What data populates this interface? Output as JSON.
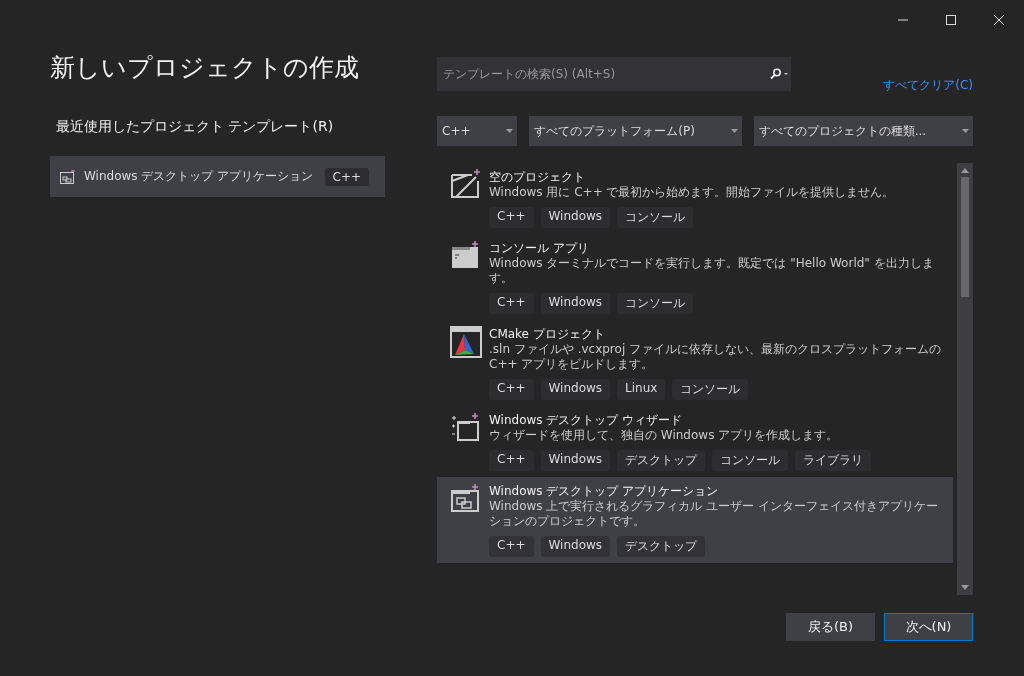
{
  "window": {
    "title": "新しいプロジェクトの作成"
  },
  "recent": {
    "heading": "最近使用したプロジェクト テンプレート(R)",
    "items": [
      {
        "name": "Windows デスクトップ アプリケーション",
        "tag": "C++",
        "kind": "desktop"
      }
    ]
  },
  "search": {
    "placeholder": "テンプレートの検索(S) (Alt+S)"
  },
  "clear_all": "すべてクリア(C)",
  "filters": [
    {
      "value": "C++"
    },
    {
      "value": "すべてのプラットフォーム(P)"
    },
    {
      "value": "すべてのプロジェクトの種類..."
    }
  ],
  "templates": [
    {
      "kind": "empty",
      "name": "空のプロジェクト",
      "description": "Windows 用に C++ で最初から始めます。開始ファイルを提供しません。",
      "tags": [
        "C++",
        "Windows",
        "コンソール"
      ],
      "selected": false
    },
    {
      "kind": "console",
      "name": "コンソール アプリ",
      "description": "Windows ターミナルでコードを実行します。既定では \"Hello World\" を出力します。",
      "tags": [
        "C++",
        "Windows",
        "コンソール"
      ],
      "selected": false
    },
    {
      "kind": "cmake",
      "name": "CMake プロジェクト",
      "description": ".sln ファイルや .vcxproj ファイルに依存しない、最新のクロスプラットフォームの C++ アプリをビルドします。",
      "tags": [
        "C++",
        "Windows",
        "Linux",
        "コンソール"
      ],
      "selected": false
    },
    {
      "kind": "wizard",
      "name": "Windows デスクトップ ウィザード",
      "description": "ウィザードを使用して、独自の Windows アプリを作成します。",
      "tags": [
        "C++",
        "Windows",
        "デスクトップ",
        "コンソール",
        "ライブラリ"
      ],
      "selected": false
    },
    {
      "kind": "desktop",
      "name": "Windows デスクトップ アプリケーション",
      "description": "Windows 上で実行されるグラフィカル ユーザー インターフェイス付きアプリケーションのプロジェクトです。",
      "tags": [
        "C++",
        "Windows",
        "デスクトップ"
      ],
      "selected": true
    }
  ],
  "buttons": [
    {
      "label": "戻る(B)",
      "primary": false
    },
    {
      "label": "次へ(N)",
      "primary": true
    }
  ]
}
